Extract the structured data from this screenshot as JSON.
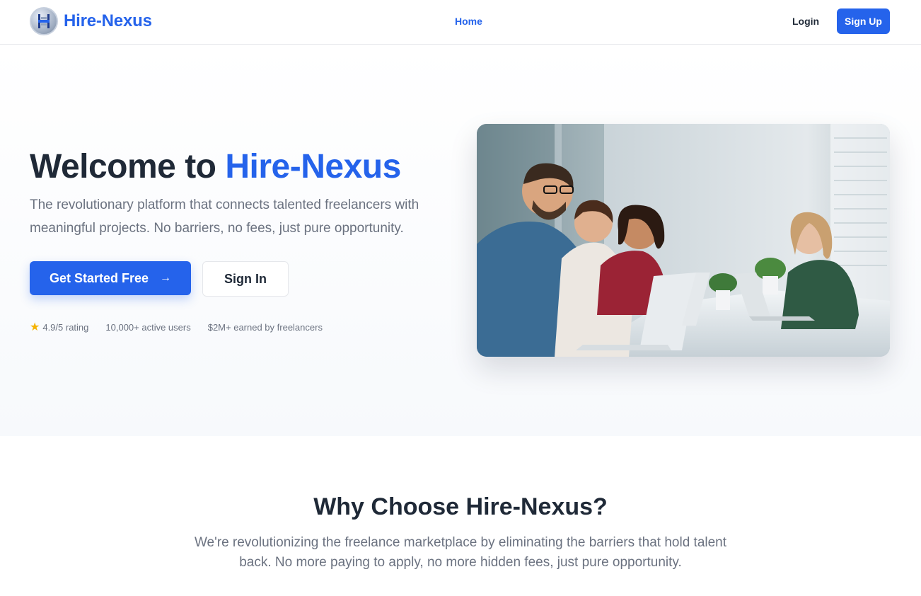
{
  "brand": {
    "name": "Hire-Nexus"
  },
  "nav": {
    "home": "Home",
    "login": "Login",
    "signup": "Sign Up"
  },
  "hero": {
    "title_prefix": "Welcome to ",
    "title_accent": "Hire-Nexus",
    "description": "The revolutionary platform that connects talented freelancers with meaningful projects. No barriers, no fees, just pure opportunity.",
    "primary_button": "Get Started Free",
    "secondary_button": "Sign In",
    "stats": [
      {
        "text": "4.9/5 rating",
        "icon": "star-icon"
      },
      {
        "text": "10,000+ active users"
      },
      {
        "text": "$2M+ earned by freelancers"
      }
    ]
  },
  "why": {
    "title": "Why Choose Hire-Nexus?",
    "description": "We're revolutionizing the freelance marketplace by eliminating the barriers that hold talent back. No more paying to apply, no more hidden fees, just pure opportunity."
  },
  "colors": {
    "accent": "#2563eb",
    "star": "#f5b301",
    "text": "#1f2937",
    "muted": "#6b7280"
  }
}
